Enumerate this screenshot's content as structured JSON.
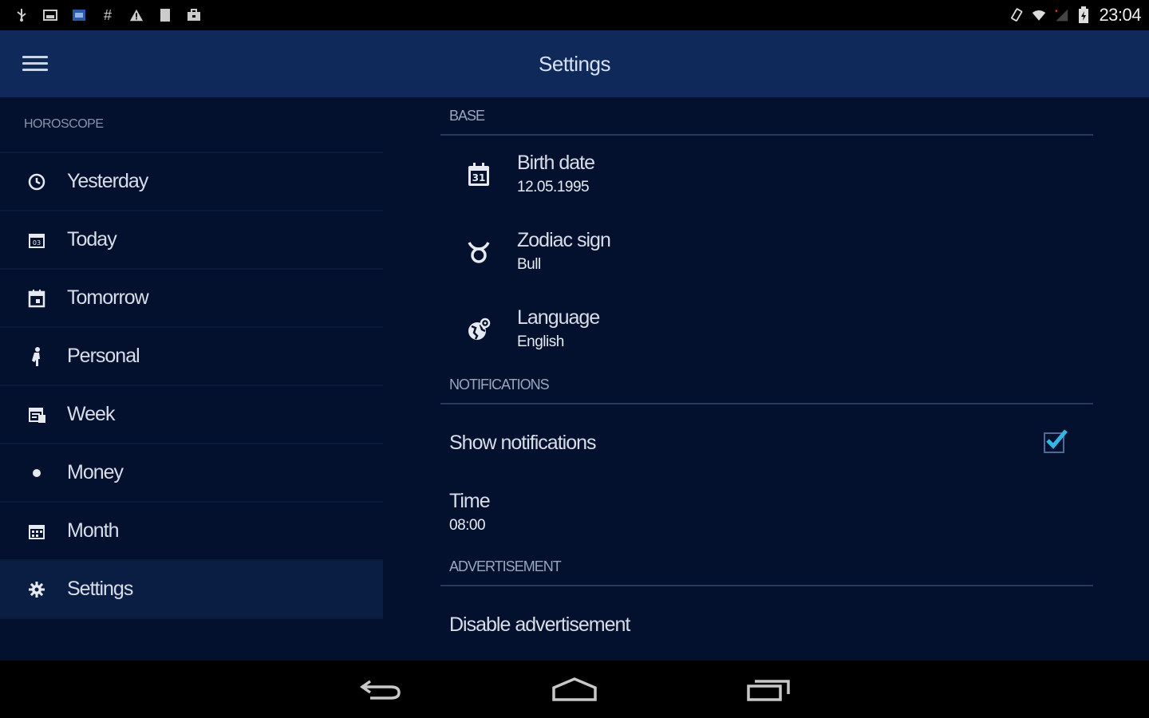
{
  "status_bar": {
    "time": "23:04"
  },
  "app_bar": {
    "title": "Settings"
  },
  "drawer": {
    "header": "HOROSCOPE",
    "items": [
      {
        "label": "Yesterday",
        "icon": "clock-icon"
      },
      {
        "label": "Today",
        "icon": "calendar-today-icon"
      },
      {
        "label": "Tomorrow",
        "icon": "calendar-tomorrow-icon"
      },
      {
        "label": "Personal",
        "icon": "person-icon"
      },
      {
        "label": "Week",
        "icon": "calendar-week-icon"
      },
      {
        "label": "Money",
        "icon": "dot-icon"
      },
      {
        "label": "Month",
        "icon": "calendar-month-icon"
      },
      {
        "label": "Settings",
        "icon": "gear-icon",
        "active": true
      }
    ]
  },
  "settings": {
    "base_header": "BASE",
    "birth_date": {
      "title": "Birth date",
      "value": "12.05.1995"
    },
    "zodiac_sign": {
      "title": "Zodiac sign",
      "value": "Bull"
    },
    "language": {
      "title": "Language",
      "value": "English"
    },
    "notifications_header": "NOTIFICATIONS",
    "show_notifications": {
      "title": "Show notifications",
      "checked": true
    },
    "time": {
      "title": "Time",
      "value": "08:00"
    },
    "advertisement_header": "ADVERTISEMENT",
    "disable_ads": {
      "title": "Disable advertisement"
    }
  },
  "colors": {
    "app_bar": "#0f2a5a",
    "background": "#03112e",
    "accent_check": "#33b5e5"
  }
}
